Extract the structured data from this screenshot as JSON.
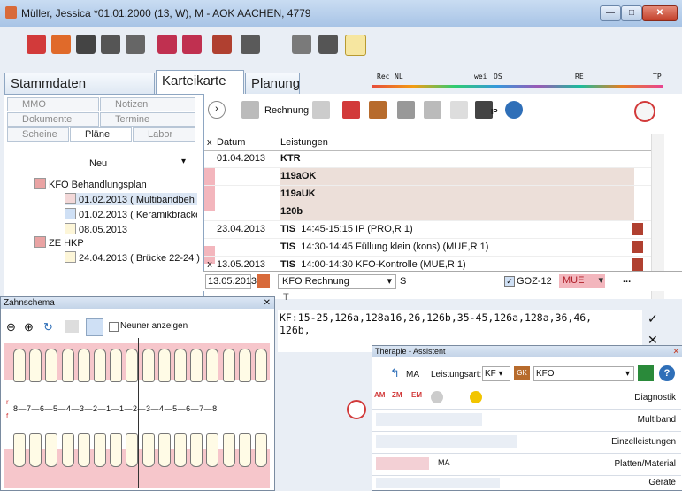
{
  "window": {
    "title": "Müller, Jessica  *01.01.2000 (13, W),  M - AOK AACHEN, 4779"
  },
  "main_tabs": [
    {
      "label": "Stammdaten"
    },
    {
      "label": "Karteikarte"
    },
    {
      "label": "Planung"
    }
  ],
  "timeline_labels": [
    "Rec",
    "NL",
    "wei",
    "OS",
    "RE",
    "TP"
  ],
  "sub_tabs": [
    {
      "label": "MMO"
    },
    {
      "label": "Notizen"
    },
    {
      "label": "Dokumente"
    },
    {
      "label": "Termine"
    },
    {
      "label": "Scheine"
    },
    {
      "label": "Pläne"
    },
    {
      "label": "Labor"
    }
  ],
  "left": {
    "new_label": "Neu",
    "tree": [
      {
        "label": "KFO Behandlungsplan"
      },
      {
        "label": "01.02.2013 ( Multibandbeh"
      },
      {
        "label": "01.02.2013 ( Keramikbracke"
      },
      {
        "label": "08.05.2013"
      },
      {
        "label": "ZE HKP"
      },
      {
        "label": "24.04.2013 ( Brücke 22-24 )"
      }
    ]
  },
  "toolbar2": {
    "rechnung_label": "Rechnung",
    "ip_label": "IP"
  },
  "table": {
    "headers": [
      "x",
      "Datum",
      "Leistungen"
    ],
    "rows": [
      {
        "x": "",
        "date": "01.04.2013",
        "text": "KTR",
        "bold": true
      },
      {
        "x": "",
        "date": "",
        "text": "119aOK",
        "bold": true
      },
      {
        "x": "",
        "date": "",
        "text": "119aUK",
        "bold": true
      },
      {
        "x": "",
        "date": "",
        "text": "120b",
        "bold": true
      },
      {
        "x": "",
        "date": "23.04.2013",
        "code": "TIS",
        "text": "14:45-15:15 IP (PRO,R 1)"
      },
      {
        "x": "",
        "date": "",
        "code": "TIS",
        "text": "14:30-14:45 Füllung klein (kons) (MUE,R 1)"
      },
      {
        "x": "x",
        "date": "13.05.2013",
        "code": "TIS",
        "text": "14:00-14:30 KFO-Kontrolle (MUE,R 1)"
      }
    ]
  },
  "entry": {
    "date": "13.05.2013",
    "type": "KFO Rechnung",
    "s_label": "S",
    "goz_label": "GOZ-12",
    "user": "MUE",
    "more": "...",
    "t_label": "T",
    "text_line1": "KF:15-25,126a,128a16,26,126b,35-45,126a,128a,36,46,",
    "text_line2": "126b,"
  },
  "zahnschema": {
    "title": "Zahnschema",
    "neuner_label": "Neuner anzeigen",
    "axis_left_top": "r",
    "axis_left_bottom": "f",
    "numbers": "8—7—6—5—4—3—2—1—1—2—3—4—5—6—7—8"
  },
  "therapie": {
    "title": "Therapie - Assistent",
    "ma_label": "MA",
    "leistungsart_label": "Leistungsart:",
    "leistungsart_value": "KF",
    "gk_label": "GK",
    "type_value": "KFO",
    "row_icon_labels": [
      "AM",
      "ZM",
      "EM",
      "MA"
    ],
    "rows": [
      {
        "label": "Diagnostik"
      },
      {
        "label": "Multiband"
      },
      {
        "label": "Einzelleistungen"
      },
      {
        "label": "Platten/Material"
      },
      {
        "label": "Geräte"
      }
    ]
  },
  "colors": {
    "accent_red": "#d23a3a",
    "pink": "#f3b6bd",
    "highlight": "#ecdfd9"
  }
}
